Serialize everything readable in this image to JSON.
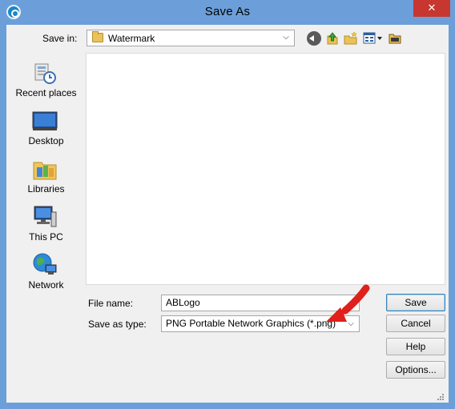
{
  "window": {
    "title": "Save As",
    "close_label": "✕"
  },
  "toolbar": {
    "save_in_label": "Save in:",
    "save_in_value": "Watermark"
  },
  "places": [
    {
      "label": "Recent places",
      "icon": "recent-places-icon"
    },
    {
      "label": "Desktop",
      "icon": "desktop-icon"
    },
    {
      "label": "Libraries",
      "icon": "libraries-icon"
    },
    {
      "label": "This PC",
      "icon": "this-pc-icon"
    },
    {
      "label": "Network",
      "icon": "network-icon"
    }
  ],
  "form": {
    "file_name_label": "File name:",
    "file_name_value": "ABLogo",
    "save_as_type_label": "Save as type:",
    "save_as_type_value": "PNG Portable Network Graphics (*.png)"
  },
  "buttons": {
    "save": "Save",
    "cancel": "Cancel",
    "help": "Help",
    "options": "Options..."
  },
  "colors": {
    "titlebar": "#6c9fd9",
    "close": "#c7372f",
    "annotation_arrow": "#e0201b"
  }
}
